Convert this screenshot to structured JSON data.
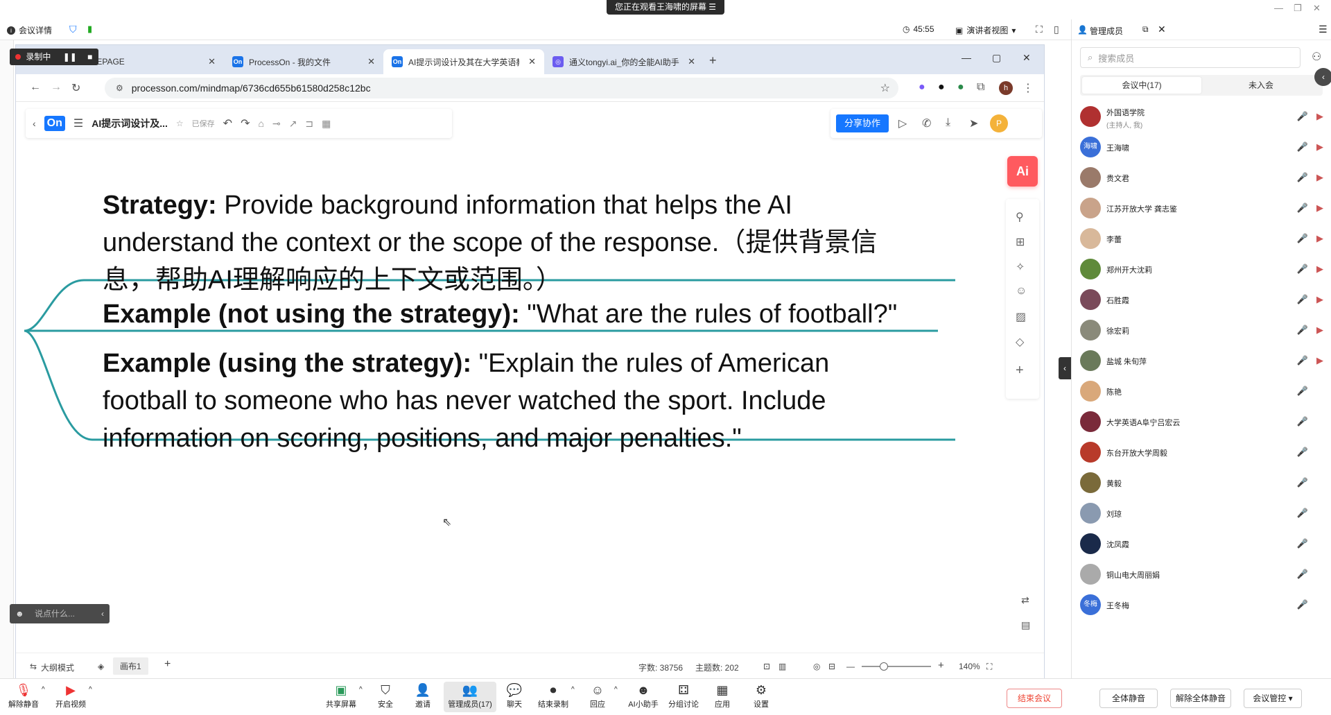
{
  "banner": "您正在观看王海啸的屏幕 ☰",
  "meeting_bar": {
    "info": "会议详情",
    "timer": "45:55",
    "view": "演讲者视图",
    "panel_title": "管理成员"
  },
  "recording": {
    "label": "录制中"
  },
  "browser": {
    "tabs": [
      {
        "label": "OMEPAGE",
        "favicon": ""
      },
      {
        "label": "ProcessOn - 我的文件",
        "favicon": "On"
      },
      {
        "label": "AI提示词设计及其在大学英语教",
        "favicon": "On"
      },
      {
        "label": "通义tongyi.ai_你的全能AI助手",
        "favicon": "◎"
      }
    ],
    "url": "processon.com/mindmap/6736cd655b61580d258c12bc",
    "profile_initial": "h"
  },
  "processon": {
    "logo": "On",
    "doc_title": "AI提示词设计及...",
    "save_status": "已保存",
    "share_label": "分享协作",
    "user_initial": "P",
    "ai_label": "Ai"
  },
  "mindmap": {
    "strategy_label": "Strategy:",
    "strategy_line1": " Provide background information that helps the AI",
    "strategy_line2": "understand the context or the scope of the response.（提供背景信",
    "strategy_line3": "息，帮助AI理解响应的上下文或范围。）",
    "example_no_label": "Example (not using the strategy):",
    "example_no_text": " \"What are the rules of football?\"",
    "example_yes_label": "Example (using the strategy):",
    "example_yes_line1": " \"Explain the rules of American",
    "example_yes_line2": "football to someone who has never watched the sport. Include",
    "example_yes_line3": "information on scoring, positions, and major penalties.\""
  },
  "status": {
    "outline_mode": "大纲模式",
    "canvas_tab": "画布1",
    "word_count": "字数: 38756",
    "topic_count": "主题数: 202",
    "zoom": "140%",
    "chat_placeholder": "说点什么..."
  },
  "right_panel": {
    "search_placeholder": "搜索成员",
    "tab_in": "会议中(17)",
    "tab_out": "未入会",
    "members": [
      {
        "name": "外国语学院",
        "sub": "(主持人, 我)",
        "avatar_text": "",
        "color": "#b03030"
      },
      {
        "name": "王海啸",
        "sub": "",
        "avatar_text": "海啸",
        "color": "#3a6fd8"
      },
      {
        "name": "贵文君",
        "sub": "",
        "avatar_text": "",
        "color": "#9a7a6a"
      },
      {
        "name": "江苏开放大学 龚志鉴",
        "sub": "",
        "avatar_text": "",
        "color": "#c9a38a"
      },
      {
        "name": "李蕾",
        "sub": "",
        "avatar_text": "",
        "color": "#d8b89a"
      },
      {
        "name": "郑州开大沈莉",
        "sub": "",
        "avatar_text": "",
        "color": "#5f8a3a"
      },
      {
        "name": "石胜霞",
        "sub": "",
        "avatar_text": "",
        "color": "#7a4a5a"
      },
      {
        "name": "徐宏莉",
        "sub": "",
        "avatar_text": "",
        "color": "#8a8a7a"
      },
      {
        "name": "盐城 朱旬萍",
        "sub": "",
        "avatar_text": "",
        "color": "#6a7a5a"
      },
      {
        "name": "陈艳",
        "sub": "",
        "avatar_text": "",
        "color": "#d9a87a"
      },
      {
        "name": "大学英语A阜宁吕宏云",
        "sub": "",
        "avatar_text": "",
        "color": "#7a2a3a"
      },
      {
        "name": "东台开放大学周毅",
        "sub": "",
        "avatar_text": "",
        "color": "#b83a2a"
      },
      {
        "name": "黄毅",
        "sub": "",
        "avatar_text": "",
        "color": "#7a6a3a"
      },
      {
        "name": "刘琼",
        "sub": "",
        "avatar_text": "",
        "color": "#8a9ab0"
      },
      {
        "name": "沈凤霞",
        "sub": "",
        "avatar_text": "",
        "color": "#1a2a4a"
      },
      {
        "name": "铜山电大周丽娟",
        "sub": "",
        "avatar_text": "",
        "color": "#aaaaaa"
      },
      {
        "name": "王冬梅",
        "sub": "",
        "avatar_text": "冬梅",
        "color": "#3a6fd8"
      }
    ]
  },
  "bottom_bar": {
    "items": [
      "解除静音",
      "开启视频",
      "共享屏幕",
      "安全",
      "邀请",
      "管理成员(17)",
      "聊天",
      "结束录制",
      "回应",
      "AI小助手",
      "分组讨论",
      "应用",
      "设置"
    ],
    "end_meeting": "结束会议",
    "mute_all": "全体静音",
    "unmute_all": "解除全体静音",
    "meeting_control": "会议管控"
  },
  "colors": {
    "branch": "#2a9ba0",
    "accent": "#1677ff",
    "ai": "#ff5a5f"
  }
}
